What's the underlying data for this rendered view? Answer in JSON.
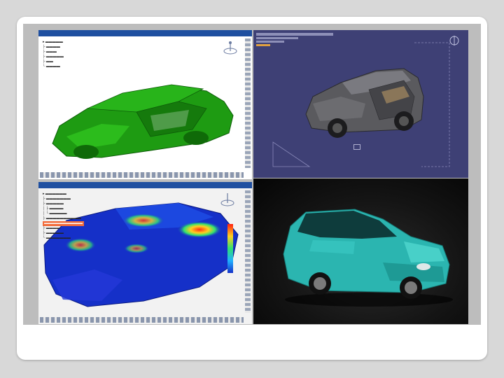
{
  "top_left": {
    "title": "",
    "tree": [
      "",
      "",
      "",
      "",
      "",
      ""
    ]
  },
  "bottom_left": {
    "title": "",
    "tree": [
      "",
      "",
      "",
      "",
      "",
      "",
      "",
      "",
      "",
      ""
    ]
  },
  "colors": {
    "cad_body_green": "#1e9b12",
    "viewport_purple": "#3e4075",
    "fem_blue": "#1530c8",
    "render_teal": "#2bb5b0"
  },
  "icons": [
    "compass-icon",
    "toolbar-icons"
  ]
}
